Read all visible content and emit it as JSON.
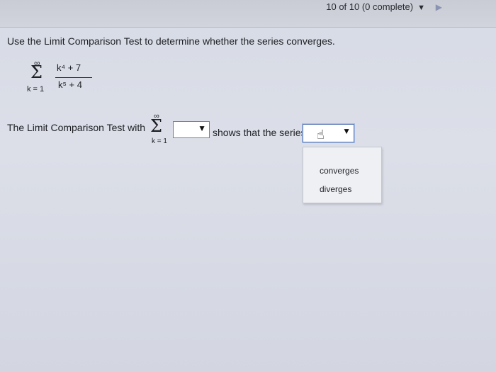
{
  "header": {
    "progress_text": "10 of 10 (0 complete)",
    "caret": "▼",
    "next_arrow": "▶"
  },
  "question": {
    "prompt": "Use the Limit Comparison Test to determine whether the series converges.",
    "series": {
      "upper_limit": "∞",
      "sigma": "Σ",
      "lower_limit": "k = 1",
      "numerator": "k⁴ + 7",
      "denominator": "k⁵ + 4"
    }
  },
  "answer_line": {
    "lead_text": "The Limit Comparison Test with",
    "comparison_series": {
      "upper_limit": "∞",
      "sigma": "Σ",
      "lower_limit": "k = 1"
    },
    "dropdown1_arrow": "▼",
    "middle_text": "shows that the series",
    "dropdown2_arrow": "▼"
  },
  "dropdown2_menu": {
    "options": [
      "converges",
      "diverges"
    ]
  },
  "icons": {
    "cursor": "hand-pointer-icon"
  }
}
